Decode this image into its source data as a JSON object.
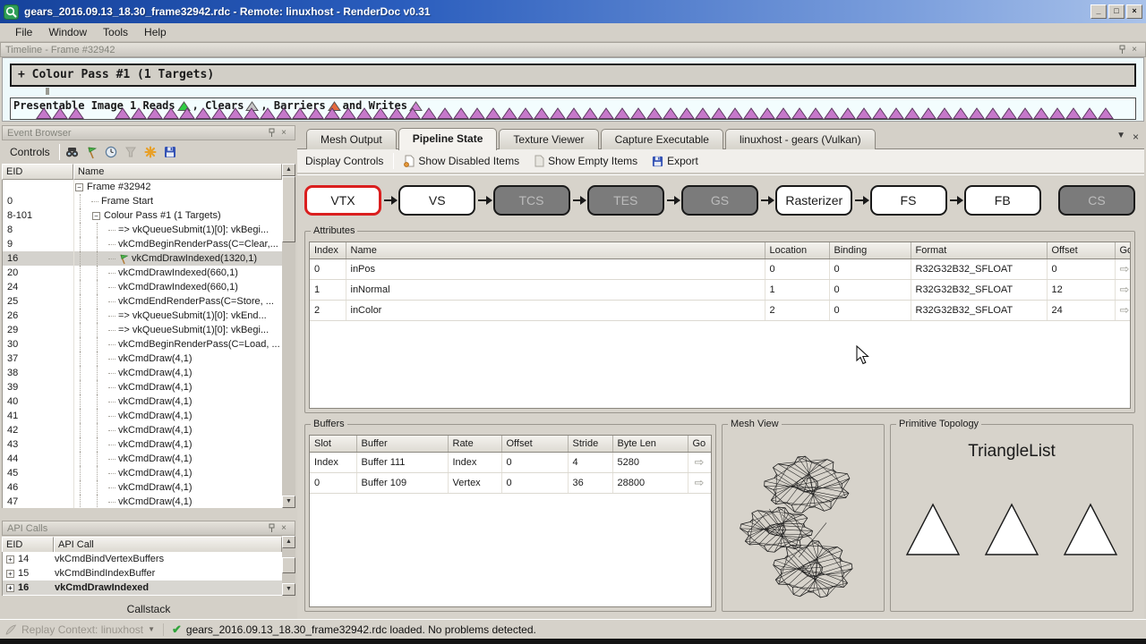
{
  "window": {
    "title": "gears_2016.09.13_18.30_frame32942.rdc - Remote: linuxhost - RenderDoc v0.31",
    "menu": [
      "File",
      "Window",
      "Tools",
      "Help"
    ],
    "controls": {
      "minimize": "_",
      "maximize": "□",
      "close": "×"
    }
  },
  "timeline": {
    "title": "Timeline - Frame #32942",
    "pass_label": "+ Colour Pass #1 (1 Targets)",
    "legend_segments": [
      {
        "text": "Presentable Image 1 Reads ",
        "marker": "reads"
      },
      {
        "text": ", Clears ",
        "marker": "clears"
      },
      {
        "text": ", Barriers ",
        "marker": "barriers"
      },
      {
        "text": " and Writes ",
        "marker": "writes"
      }
    ],
    "marker_colors": {
      "reads": "#2fce43",
      "clears": "#c6c6c6",
      "barriers": "#e66a3e",
      "writes": "#cd7fd0"
    },
    "event_triangle_color": "#c678ca",
    "triangle_groups": [
      3,
      62
    ]
  },
  "event_browser": {
    "title": "Event Browser",
    "controls_label": "Controls",
    "columns": [
      "EID",
      "Name"
    ],
    "rows": [
      {
        "eid": "",
        "name": "Frame #32942",
        "depth": 0,
        "expand": "-"
      },
      {
        "eid": "0",
        "name": "Frame Start",
        "depth": 1,
        "expand": ""
      },
      {
        "eid": "8-101",
        "name": "Colour Pass #1 (1 Targets)",
        "depth": 1,
        "expand": "-"
      },
      {
        "eid": "8",
        "name": "=> vkQueueSubmit(1)[0]: vkBegi...",
        "depth": 2,
        "expand": ""
      },
      {
        "eid": "9",
        "name": "vkCmdBeginRenderPass(C=Clear,...",
        "depth": 2,
        "expand": ""
      },
      {
        "eid": "16",
        "name": "vkCmdDrawIndexed(1320,1)",
        "depth": 2,
        "expand": "",
        "selected": true,
        "flag": true
      },
      {
        "eid": "20",
        "name": "vkCmdDrawIndexed(660,1)",
        "depth": 2,
        "expand": ""
      },
      {
        "eid": "24",
        "name": "vkCmdDrawIndexed(660,1)",
        "depth": 2,
        "expand": ""
      },
      {
        "eid": "25",
        "name": "vkCmdEndRenderPass(C=Store, ...",
        "depth": 2,
        "expand": ""
      },
      {
        "eid": "26",
        "name": "=> vkQueueSubmit(1)[0]: vkEnd...",
        "depth": 2,
        "expand": ""
      },
      {
        "eid": "29",
        "name": "=> vkQueueSubmit(1)[0]: vkBegi...",
        "depth": 2,
        "expand": ""
      },
      {
        "eid": "30",
        "name": "vkCmdBeginRenderPass(C=Load, ...",
        "depth": 2,
        "expand": ""
      },
      {
        "eid": "37",
        "name": "vkCmdDraw(4,1)",
        "depth": 2,
        "expand": ""
      },
      {
        "eid": "38",
        "name": "vkCmdDraw(4,1)",
        "depth": 2,
        "expand": ""
      },
      {
        "eid": "39",
        "name": "vkCmdDraw(4,1)",
        "depth": 2,
        "expand": ""
      },
      {
        "eid": "40",
        "name": "vkCmdDraw(4,1)",
        "depth": 2,
        "expand": ""
      },
      {
        "eid": "41",
        "name": "vkCmdDraw(4,1)",
        "depth": 2,
        "expand": ""
      },
      {
        "eid": "42",
        "name": "vkCmdDraw(4,1)",
        "depth": 2,
        "expand": ""
      },
      {
        "eid": "43",
        "name": "vkCmdDraw(4,1)",
        "depth": 2,
        "expand": ""
      },
      {
        "eid": "44",
        "name": "vkCmdDraw(4,1)",
        "depth": 2,
        "expand": ""
      },
      {
        "eid": "45",
        "name": "vkCmdDraw(4,1)",
        "depth": 2,
        "expand": ""
      },
      {
        "eid": "46",
        "name": "vkCmdDraw(4,1)",
        "depth": 2,
        "expand": ""
      },
      {
        "eid": "47",
        "name": "vkCmdDraw(4,1)",
        "depth": 2,
        "expand": ""
      }
    ]
  },
  "api_calls": {
    "title": "API Calls",
    "columns": [
      "EID",
      "API Call"
    ],
    "rows": [
      {
        "eid": "14",
        "call": "vkCmdBindVertexBuffers",
        "selected": false
      },
      {
        "eid": "15",
        "call": "vkCmdBindIndexBuffer",
        "selected": false
      },
      {
        "eid": "16",
        "call": "vkCmdDrawIndexed",
        "selected": true
      }
    ],
    "callstack_label": "Callstack"
  },
  "main": {
    "tabs": [
      {
        "label": "Mesh Output",
        "active": false
      },
      {
        "label": "Pipeline State",
        "active": true
      },
      {
        "label": "Texture Viewer",
        "active": false
      },
      {
        "label": "Capture Executable",
        "active": false
      },
      {
        "label": "linuxhost - gears (Vulkan)",
        "active": false
      }
    ],
    "toolbar": {
      "display_controls": "Display Controls",
      "show_disabled": "Show Disabled Items",
      "show_empty": "Show Empty Items",
      "export": "Export"
    },
    "pipeline": {
      "stages": [
        {
          "label": "VTX",
          "state": "current"
        },
        {
          "label": "VS",
          "state": "enabled"
        },
        {
          "label": "TCS",
          "state": "disabled"
        },
        {
          "label": "TES",
          "state": "disabled"
        },
        {
          "label": "GS",
          "state": "disabled"
        },
        {
          "label": "Rasterizer",
          "state": "enabled"
        },
        {
          "label": "FS",
          "state": "enabled"
        },
        {
          "label": "FB",
          "state": "enabled"
        },
        {
          "label": "CS",
          "state": "disabled",
          "detached": true
        }
      ]
    },
    "attributes": {
      "title": "Attributes",
      "columns": [
        "Index",
        "Name",
        "Location",
        "Binding",
        "Format",
        "Offset",
        "Go"
      ],
      "rows": [
        [
          "0",
          "inPos",
          "0",
          "0",
          "R32G32B32_SFLOAT",
          "0"
        ],
        [
          "1",
          "inNormal",
          "1",
          "0",
          "R32G32B32_SFLOAT",
          "12"
        ],
        [
          "2",
          "inColor",
          "2",
          "0",
          "R32G32B32_SFLOAT",
          "24"
        ]
      ]
    },
    "buffers": {
      "title": "Buffers",
      "columns": [
        "Slot",
        "Buffer",
        "Rate",
        "Offset",
        "Stride",
        "Byte Len",
        "Go"
      ],
      "rows": [
        [
          "Index",
          "Buffer 111",
          "Index",
          "0",
          "4",
          "5280"
        ],
        [
          "0",
          "Buffer 109",
          "Vertex",
          "0",
          "36",
          "28800"
        ]
      ]
    },
    "mesh_view": {
      "title": "Mesh View"
    },
    "topology": {
      "title": "Primitive Topology",
      "value": "TriangleList",
      "triangle_count": 3
    }
  },
  "status_bar": {
    "replay_context": "Replay Context: linuxhost",
    "message": "gears_2016.09.13_18.30_frame32942.rdc loaded. No problems detected."
  }
}
